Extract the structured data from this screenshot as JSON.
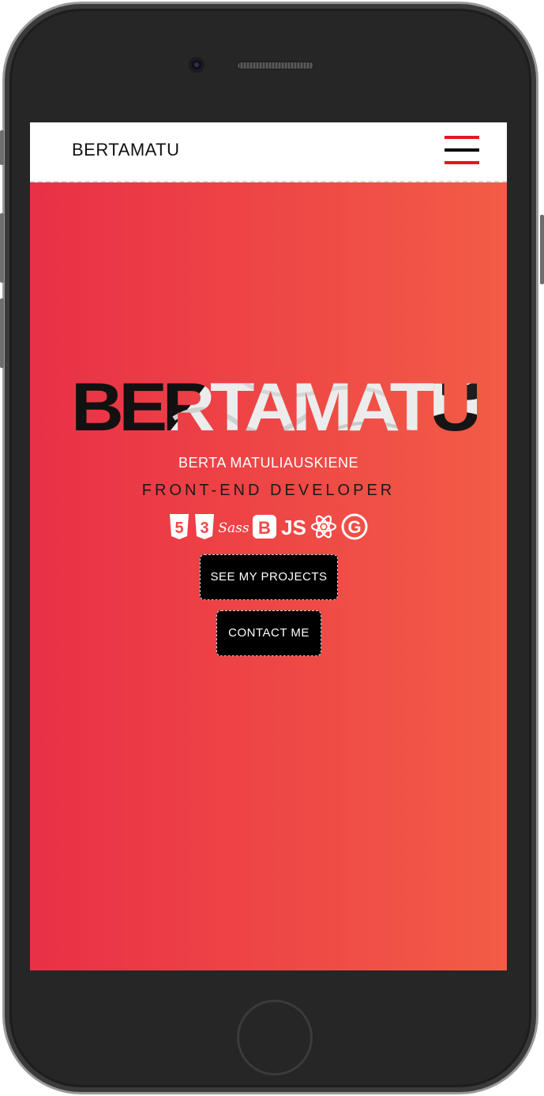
{
  "navbar": {
    "brand": "BERTAMATU",
    "menu_icon": "hamburger-menu-icon"
  },
  "hero": {
    "title": "BERTAMATU",
    "full_name": "BERTA MATULIAUSKIENE",
    "role": "FRONT-END DEVELOPER",
    "tech_icons": [
      {
        "name": "html5-icon",
        "label": "5"
      },
      {
        "name": "css3-icon",
        "label": "3"
      },
      {
        "name": "sass-icon",
        "label": "Sass"
      },
      {
        "name": "bootstrap-icon",
        "label": "B"
      },
      {
        "name": "javascript-icon",
        "label": "JS"
      },
      {
        "name": "react-icon",
        "label": ""
      },
      {
        "name": "gatsby-icon",
        "label": "G"
      }
    ],
    "buttons": {
      "projects": "SEE MY PROJECTS",
      "contact": "CONTACT ME"
    }
  },
  "colors": {
    "gradient_start": "#e93046",
    "gradient_end": "#f35c46",
    "hamburger_red": "#e8141e",
    "hamburger_black": "#000000",
    "button_bg": "#000000"
  }
}
